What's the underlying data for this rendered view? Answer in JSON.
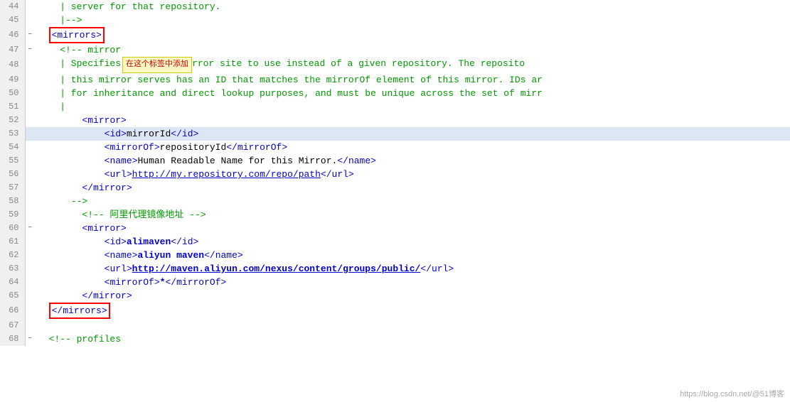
{
  "watermark": "https://blog.csdn.net/@51博客",
  "lines": [
    {
      "num": 44,
      "fold": "",
      "highlighted": false,
      "html": "<span class='xml-comment'>    | server for that repository.</span>"
    },
    {
      "num": 45,
      "fold": "",
      "highlighted": false,
      "html": "<span class='xml-comment'>    |--&gt;</span>"
    },
    {
      "num": 46,
      "fold": "−",
      "highlighted": false,
      "html": "  <span class='red-box'><span class='xml-bracket'>&lt;</span><span class='xml-tag'>mirrors</span><span class='xml-bracket'>&gt;</span></span>"
    },
    {
      "num": 47,
      "fold": "−",
      "highlighted": false,
      "html": "    <span class='xml-comment'>&lt;!-- mirror</span>"
    },
    {
      "num": 48,
      "fold": "",
      "highlighted": false,
      "html": "<span class='xml-comment'>    | Specifies</span><span class='tooltip-bubble'>在这个标签中添加</span><span class='xml-comment'>rror site to use instead of a given repository. The reposito</span>"
    },
    {
      "num": 49,
      "fold": "",
      "highlighted": false,
      "html": "<span class='xml-comment'>    | this mirror serves has an ID that matches the mirrorOf element of this mirror. IDs ar</span>"
    },
    {
      "num": 50,
      "fold": "",
      "highlighted": false,
      "html": "<span class='xml-comment'>    | for inheritance and direct lookup purposes, and must be unique across the set of mirr</span>"
    },
    {
      "num": 51,
      "fold": "",
      "highlighted": false,
      "html": "<span class='xml-comment'>    |</span>"
    },
    {
      "num": 52,
      "fold": "",
      "highlighted": false,
      "html": "        <span class='xml-bracket'>&lt;</span><span class='xml-tag'>mirror</span><span class='xml-bracket'>&gt;</span>"
    },
    {
      "num": 53,
      "fold": "",
      "highlighted": true,
      "html": "            <span class='xml-bracket'>&lt;</span><span class='xml-tag'>id</span><span class='xml-bracket'>&gt;</span><span class='xml-text'>mirrorId</span><span class='xml-bracket'>&lt;/</span><span class='xml-tag'>id</span><span class='xml-bracket'>&gt;</span>"
    },
    {
      "num": 54,
      "fold": "",
      "highlighted": false,
      "html": "            <span class='xml-bracket'>&lt;</span><span class='xml-tag'>mirrorOf</span><span class='xml-bracket'>&gt;</span><span class='xml-text'>repositoryId</span><span class='xml-bracket'>&lt;/</span><span class='xml-tag'>mirrorOf</span><span class='xml-bracket'>&gt;</span>"
    },
    {
      "num": 55,
      "fold": "",
      "highlighted": false,
      "html": "            <span class='xml-bracket'>&lt;</span><span class='xml-tag'>name</span><span class='xml-bracket'>&gt;</span><span class='xml-text'>Human Readable Name for this Mirror.</span><span class='xml-bracket'>&lt;/</span><span class='xml-tag'>name</span><span class='xml-bracket'>&gt;</span>"
    },
    {
      "num": 56,
      "fold": "",
      "highlighted": false,
      "html": "            <span class='xml-bracket'>&lt;</span><span class='xml-tag'>url</span><span class='xml-bracket'>&gt;</span><span class='xml-url'>http://my.repository.com/repo/path</span><span class='xml-bracket'>&lt;/</span><span class='xml-tag'>url</span><span class='xml-bracket'>&gt;</span>"
    },
    {
      "num": 57,
      "fold": "",
      "highlighted": false,
      "html": "        <span class='xml-bracket'>&lt;/</span><span class='xml-tag'>mirror</span><span class='xml-bracket'>&gt;</span>"
    },
    {
      "num": 58,
      "fold": "",
      "highlighted": false,
      "html": "      <span class='xml-comment'>--&gt;</span>"
    },
    {
      "num": 59,
      "fold": "",
      "highlighted": false,
      "html": "        <span class='xml-comment'>&lt;!-- 阿里代理镜像地址 --&gt;</span>"
    },
    {
      "num": 60,
      "fold": "−",
      "highlighted": false,
      "html": "        <span class='xml-bracket'>&lt;</span><span class='xml-tag'>mirror</span><span class='xml-bracket'>&gt;</span>"
    },
    {
      "num": 61,
      "fold": "",
      "highlighted": false,
      "html": "            <span class='xml-bracket'>&lt;</span><span class='xml-tag'>id</span><span class='xml-bracket'>&gt;</span><span class='xml-bold'>alimaven</span><span class='xml-bracket'>&lt;/</span><span class='xml-tag'>id</span><span class='xml-bracket'>&gt;</span>"
    },
    {
      "num": 62,
      "fold": "",
      "highlighted": false,
      "html": "            <span class='xml-bracket'>&lt;</span><span class='xml-tag'>name</span><span class='xml-bracket'>&gt;</span><span class='xml-bold'>aliyun maven</span><span class='xml-bracket'>&lt;/</span><span class='xml-tag'>name</span><span class='xml-bracket'>&gt;</span>"
    },
    {
      "num": 63,
      "fold": "",
      "highlighted": false,
      "html": "            <span class='xml-bracket'>&lt;</span><span class='xml-tag'>url</span><span class='xml-bracket'>&gt;</span><span class='xml-bold-url'>http://maven.aliyun.com/nexus/content/groups/public/</span><span class='xml-bracket'>&lt;/</span><span class='xml-tag'>url</span><span class='xml-bracket'>&gt;</span>"
    },
    {
      "num": 64,
      "fold": "",
      "highlighted": false,
      "html": "            <span class='xml-bracket'>&lt;</span><span class='xml-tag'>mirrorOf</span><span class='xml-bracket'>&gt;</span><span class='xml-bold'>*</span><span class='xml-bracket'>&lt;/</span><span class='xml-tag'>mirrorOf</span><span class='xml-bracket'>&gt;</span>"
    },
    {
      "num": 65,
      "fold": "",
      "highlighted": false,
      "html": "        <span class='xml-bracket'>&lt;/</span><span class='xml-tag'>mirror</span><span class='xml-bracket'>&gt;</span>"
    },
    {
      "num": 66,
      "fold": "",
      "highlighted": false,
      "html": "  <span class='red-box'><span class='xml-bracket'>&lt;/</span><span class='xml-tag'>mirrors</span><span class='xml-bracket'>&gt;</span></span>"
    },
    {
      "num": 67,
      "fold": "",
      "highlighted": false,
      "html": ""
    },
    {
      "num": 68,
      "fold": "−",
      "highlighted": false,
      "html": "  <span class='xml-comment'>&lt;!-- profiles</span>"
    }
  ]
}
